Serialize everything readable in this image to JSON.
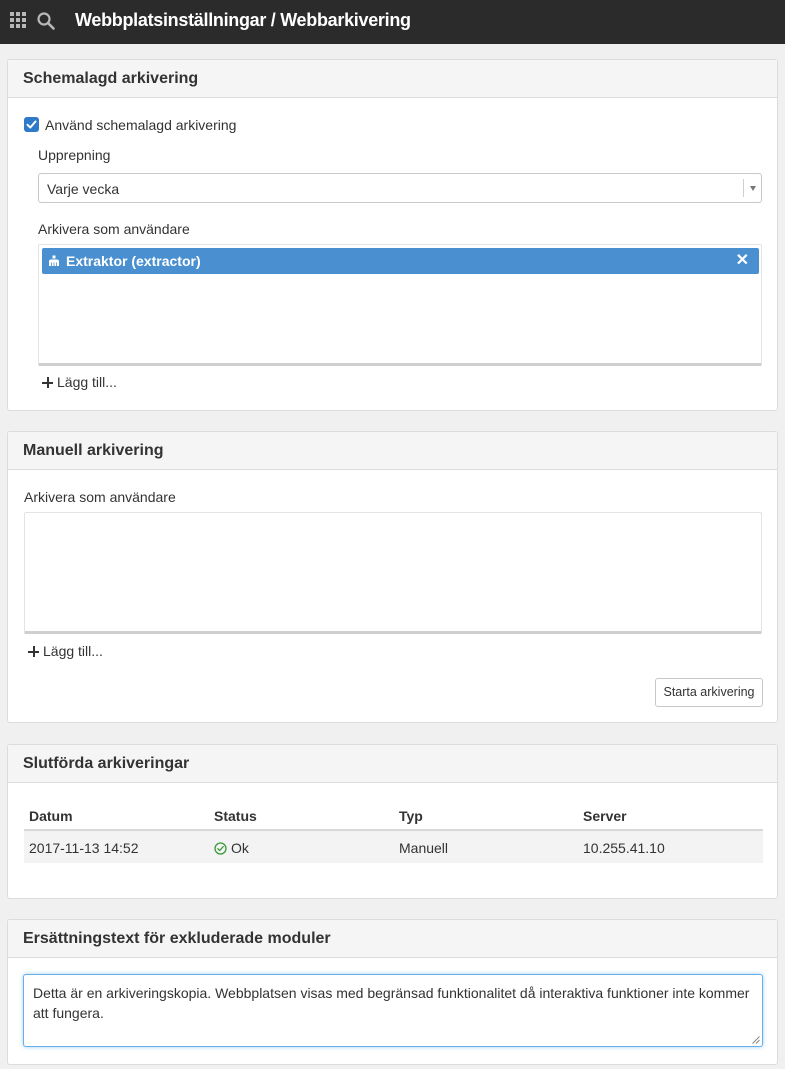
{
  "topbar": {
    "title": "Webbplatsinställningar / Webbarkivering"
  },
  "scheduled": {
    "header": "Schemalagd arkivering",
    "checkbox_label": "Använd schemalagd arkivering",
    "checkbox_checked": true,
    "repeat_label": "Upprepning",
    "repeat_value": "Varje vecka",
    "archive_as_label": "Arkivera som användare",
    "users": [
      {
        "label": "Extraktor (extractor)",
        "icon": "user-icon"
      }
    ],
    "remove_glyph": "✕",
    "add_label": "Lägg till..."
  },
  "manual": {
    "header": "Manuell arkivering",
    "archive_as_label": "Arkivera som användare",
    "add_label": "Lägg till...",
    "start_button": "Starta arkivering"
  },
  "completed": {
    "header": "Slutförda arkiveringar",
    "columns": [
      "Datum",
      "Status",
      "Typ",
      "Server"
    ],
    "rows": [
      {
        "date": "2017-11-13 14:52",
        "status": "Ok",
        "type": "Manuell",
        "server": "10.255.41.10"
      }
    ]
  },
  "replacement": {
    "header": "Ersättningstext för exkluderade moduler",
    "text": "Detta är en arkiveringskopia. Webbplatsen visas med begränsad funktionalitet då interaktiva funktioner inte kommer att fungera."
  },
  "colors": {
    "topbar": "#2b2b2b",
    "accent": "#4a90d1",
    "checkbox": "#2f7ac8",
    "ok_green": "#3a9a3a"
  }
}
